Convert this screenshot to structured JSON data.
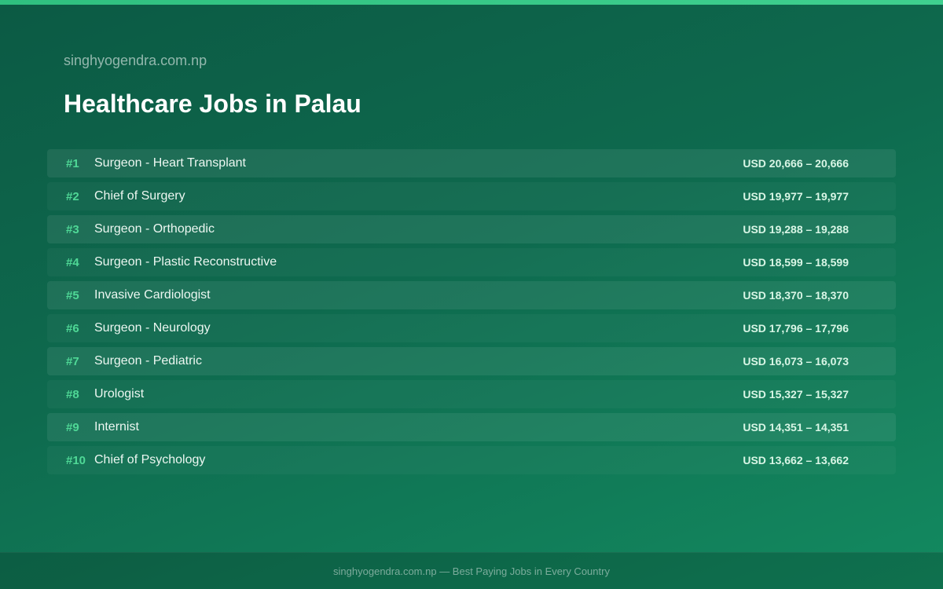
{
  "header": {
    "site_name": "singhyogendra.com.np",
    "title": "Healthcare Jobs in Palau"
  },
  "jobs": [
    {
      "rank": "#1",
      "title": "Surgeon - Heart Transplant",
      "salary": "USD 20,666 – 20,666"
    },
    {
      "rank": "#2",
      "title": "Chief of Surgery",
      "salary": "USD 19,977 – 19,977"
    },
    {
      "rank": "#3",
      "title": "Surgeon - Orthopedic",
      "salary": "USD 19,288 – 19,288"
    },
    {
      "rank": "#4",
      "title": "Surgeon - Plastic Reconstructive",
      "salary": "USD 18,599 – 18,599"
    },
    {
      "rank": "#5",
      "title": "Invasive Cardiologist",
      "salary": "USD 18,370 – 18,370"
    },
    {
      "rank": "#6",
      "title": "Surgeon - Neurology",
      "salary": "USD 17,796 – 17,796"
    },
    {
      "rank": "#7",
      "title": "Surgeon - Pediatric",
      "salary": "USD 16,073 – 16,073"
    },
    {
      "rank": "#8",
      "title": "Urologist",
      "salary": "USD 15,327 – 15,327"
    },
    {
      "rank": "#9",
      "title": "Internist",
      "salary": "USD 14,351 – 14,351"
    },
    {
      "rank": "#10",
      "title": "Chief of Psychology",
      "salary": "USD 13,662 – 13,662"
    }
  ],
  "footer": {
    "text": "singhyogendra.com.np — Best Paying Jobs in Every Country"
  },
  "colors": {
    "background": "#0e6a4e",
    "accent": "#4fd896",
    "top_bar": "#2fc07f"
  }
}
